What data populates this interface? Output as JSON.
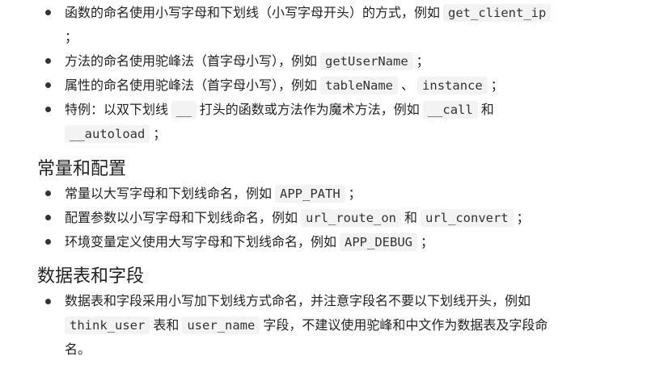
{
  "naming_list_1": {
    "item1": {
      "text_before": "函数的命名使用小写字母和下划线（小写字母开头）的方式，例如",
      "code": "get_client_ip",
      "text_after": "；"
    },
    "item2": {
      "text_before": "方法的命名使用驼峰法（首字母小写），例如",
      "code": "getUserName",
      "text_after": "；"
    },
    "item3": {
      "text_before": "属性的命名使用驼峰法（首字母小写），例如",
      "code1": "tableName",
      "sep": "、",
      "code2": "instance",
      "text_after": "；"
    },
    "item4": {
      "text_before": "特例：以双下划线",
      "code1": "__",
      "text_mid": "打头的函数或方法作为魔术方法，例如",
      "code2": "__call",
      "text_and": "和",
      "code3": "__autoload",
      "text_after": "；"
    }
  },
  "section_constants": {
    "heading": "常量和配置",
    "item1": {
      "text_before": "常量以大写字母和下划线命名，例如",
      "code": "APP_PATH",
      "text_after": "；"
    },
    "item2": {
      "text_before": "配置参数以小写字母和下划线命名，例如",
      "code1": "url_route_on",
      "text_and": "和",
      "code2": "url_convert",
      "text_after": "；"
    },
    "item3": {
      "text_before": "环境变量定义使用大写字母和下划线命名，例如",
      "code": "APP_DEBUG",
      "text_after": "；"
    }
  },
  "section_tables": {
    "heading": "数据表和字段",
    "item1": {
      "text_before": "数据表和字段采用小写加下划线方式命名，并注意字段名不要以下划线开头，例如",
      "code1": "think_user",
      "text_mid1": "表和",
      "code2": "user_name",
      "text_mid2": "字段，不建议使用驼峰和中文作为数据表及字段命",
      "text_end": "名。"
    }
  }
}
